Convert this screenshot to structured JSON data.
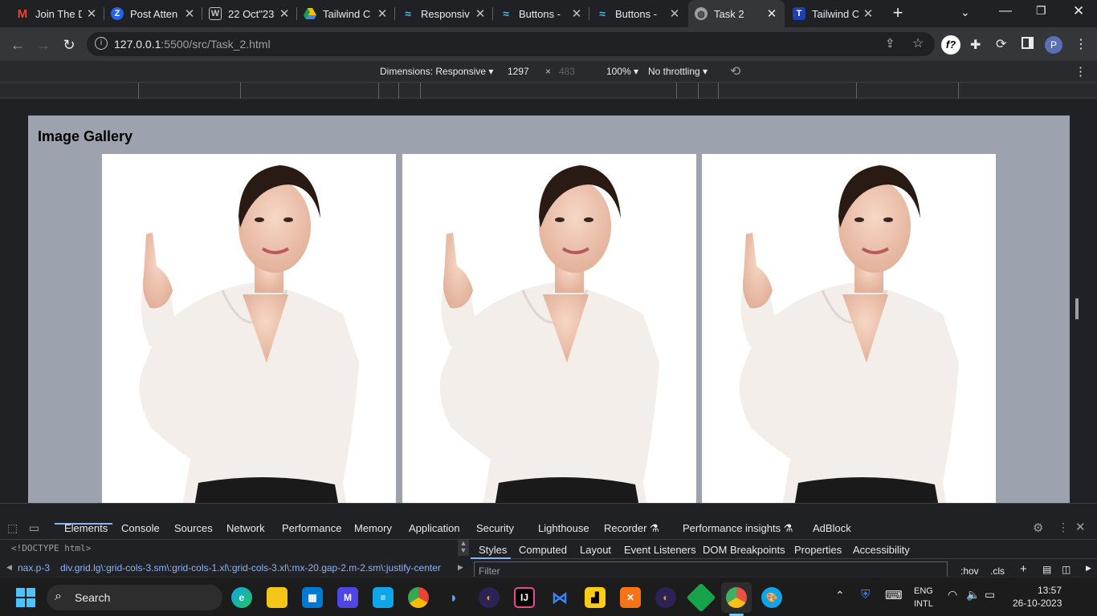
{
  "tabs": [
    {
      "title": "Join The D",
      "icon": "gmail-icon"
    },
    {
      "title": "Post Atten",
      "icon": "z-icon"
    },
    {
      "title": "22 Oct\"23",
      "icon": "wordpress-icon"
    },
    {
      "title": "Tailwind C",
      "icon": "drive-icon"
    },
    {
      "title": "Responsiv",
      "icon": "tailwind-icon"
    },
    {
      "title": "Buttons -",
      "icon": "tailwind-icon"
    },
    {
      "title": "Buttons -",
      "icon": "tailwind-icon"
    },
    {
      "title": "Task 2",
      "icon": "globe-icon",
      "active": true
    },
    {
      "title": "Tailwind C",
      "icon": "t-icon"
    }
  ],
  "address": {
    "host": "127.0.0.1",
    "path": ":5500/src/Task_2.html"
  },
  "profile_initial": "P",
  "device_toolbar": {
    "dimensions_label": "Dimensions: Responsive",
    "width": "1297",
    "times": "×",
    "height": "483",
    "zoom": "100%",
    "throttling": "No throttling"
  },
  "page": {
    "heading": "Image Gallery"
  },
  "devtools": {
    "tabs": [
      "Elements",
      "Console",
      "Sources",
      "Network",
      "Performance",
      "Memory",
      "Application",
      "Security",
      "Lighthouse",
      "Recorder",
      "Performance insights",
      "AdBlock"
    ],
    "doctype": "<!DOCTYPE html>",
    "breadcrumb_prev": "nax.p-3",
    "breadcrumb": "div.grid.lg\\:grid-cols-3.sm\\:grid-cols-1.xl\\:grid-cols-3.xl\\:mx-20.gap-2.m-2.sm\\:justify-center",
    "side_tabs": [
      "Styles",
      "Computed",
      "Layout",
      "Event Listeners",
      "DOM Breakpoints",
      "Properties",
      "Accessibility"
    ],
    "filter_placeholder": "Filter",
    "hov": ":hov",
    "cls": ".cls"
  },
  "taskbar": {
    "search_label": "Search",
    "lang": "ENG",
    "lang2": "INTL",
    "time": "13:57",
    "date": "26-10-2023"
  },
  "colors": {
    "page_bg": "#9ca3af",
    "devtools_accent": "#8ab4f8"
  }
}
